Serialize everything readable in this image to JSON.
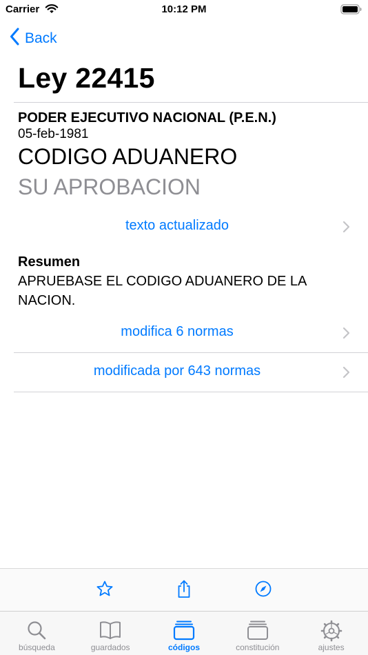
{
  "status_bar": {
    "carrier": "Carrier",
    "time": "10:12 PM"
  },
  "nav": {
    "back_label": "Back"
  },
  "law": {
    "title": "Ley 22415",
    "issuer": "PODER EJECUTIVO NACIONAL (P.E.N.)",
    "date": "05-feb-1981",
    "code_name": "CODIGO ADUANERO",
    "subtitle": "SU APROBACION"
  },
  "links": {
    "updated_text": "texto actualizado",
    "modifies": "modifica 6 normas",
    "modified_by": "modificada por 643 normas"
  },
  "summary": {
    "heading": "Resumen",
    "text": "APRUEBASE EL CODIGO ADUANERO DE LA NACION."
  },
  "toolbar": {
    "icons": [
      "star-icon",
      "share-icon",
      "compass-icon"
    ]
  },
  "tabs": [
    {
      "label": "búsqueda",
      "icon": "magnifier-icon",
      "active": false
    },
    {
      "label": "guardados",
      "icon": "book-icon",
      "active": false
    },
    {
      "label": "códigos",
      "icon": "stack-icon",
      "active": true
    },
    {
      "label": "constitución",
      "icon": "stack-icon",
      "active": false
    },
    {
      "label": "ajustes",
      "icon": "gear-icon",
      "active": false
    }
  ],
  "colors": {
    "accent": "#007aff",
    "secondary_text": "#8e8e93",
    "separator": "#d1d1d6",
    "chevron": "#c4c4c7"
  }
}
